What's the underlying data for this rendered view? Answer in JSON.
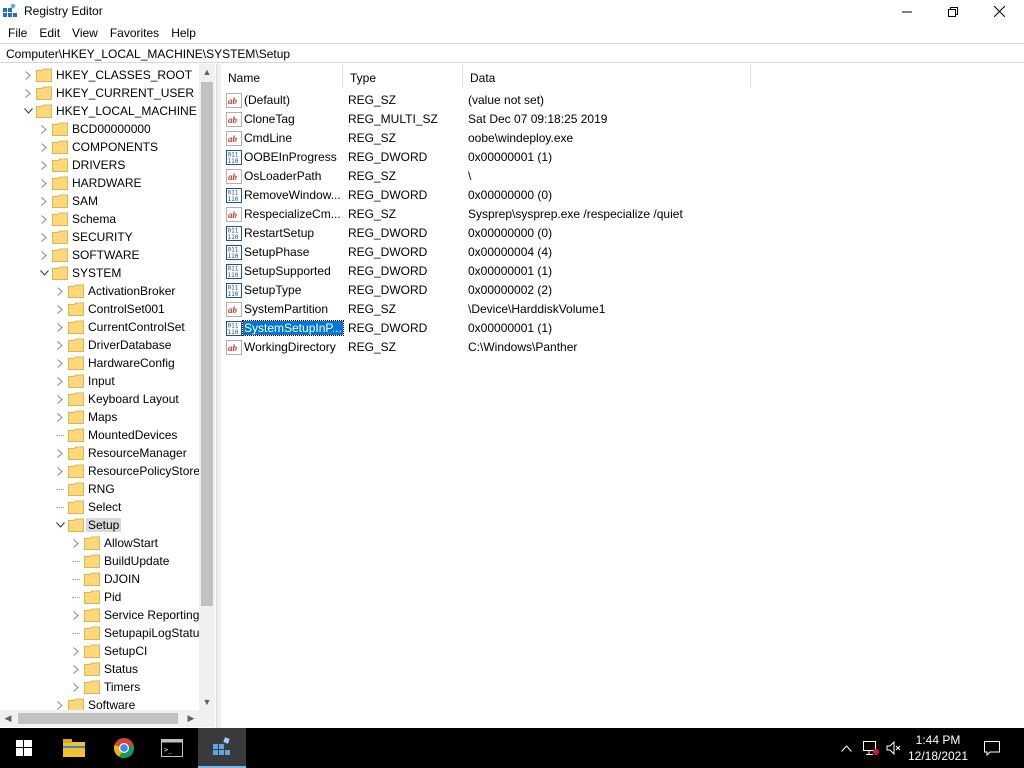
{
  "window": {
    "title": "Registry Editor"
  },
  "menu": [
    "File",
    "Edit",
    "View",
    "Favorites",
    "Help"
  ],
  "address": "Computer\\HKEY_LOCAL_MACHINE\\SYSTEM\\Setup",
  "tree": [
    {
      "label": "HKEY_CLASSES_ROOT",
      "level": 0,
      "expander": "collapsed"
    },
    {
      "label": "HKEY_CURRENT_USER",
      "level": 0,
      "expander": "collapsed"
    },
    {
      "label": "HKEY_LOCAL_MACHINE",
      "level": 0,
      "expander": "expanded"
    },
    {
      "label": "BCD00000000",
      "level": 1,
      "expander": "collapsed"
    },
    {
      "label": "COMPONENTS",
      "level": 1,
      "expander": "collapsed"
    },
    {
      "label": "DRIVERS",
      "level": 1,
      "expander": "collapsed"
    },
    {
      "label": "HARDWARE",
      "level": 1,
      "expander": "collapsed"
    },
    {
      "label": "SAM",
      "level": 1,
      "expander": "collapsed"
    },
    {
      "label": "Schema",
      "level": 1,
      "expander": "collapsed"
    },
    {
      "label": "SECURITY",
      "level": 1,
      "expander": "collapsed"
    },
    {
      "label": "SOFTWARE",
      "level": 1,
      "expander": "collapsed"
    },
    {
      "label": "SYSTEM",
      "level": 1,
      "expander": "expanded"
    },
    {
      "label": "ActivationBroker",
      "level": 2,
      "expander": "collapsed"
    },
    {
      "label": "ControlSet001",
      "level": 2,
      "expander": "collapsed"
    },
    {
      "label": "CurrentControlSet",
      "level": 2,
      "expander": "collapsed"
    },
    {
      "label": "DriverDatabase",
      "level": 2,
      "expander": "collapsed"
    },
    {
      "label": "HardwareConfig",
      "level": 2,
      "expander": "collapsed"
    },
    {
      "label": "Input",
      "level": 2,
      "expander": "collapsed"
    },
    {
      "label": "Keyboard Layout",
      "level": 2,
      "expander": "collapsed"
    },
    {
      "label": "Maps",
      "level": 2,
      "expander": "collapsed"
    },
    {
      "label": "MountedDevices",
      "level": 2,
      "expander": "none"
    },
    {
      "label": "ResourceManager",
      "level": 2,
      "expander": "collapsed"
    },
    {
      "label": "ResourcePolicyStore",
      "level": 2,
      "expander": "collapsed"
    },
    {
      "label": "RNG",
      "level": 2,
      "expander": "none"
    },
    {
      "label": "Select",
      "level": 2,
      "expander": "none"
    },
    {
      "label": "Setup",
      "level": 2,
      "expander": "expanded",
      "selected": true
    },
    {
      "label": "AllowStart",
      "level": 3,
      "expander": "collapsed"
    },
    {
      "label": "BuildUpdate",
      "level": 3,
      "expander": "none"
    },
    {
      "label": "DJOIN",
      "level": 3,
      "expander": "none"
    },
    {
      "label": "Pid",
      "level": 3,
      "expander": "none"
    },
    {
      "label": "Service Reporting",
      "level": 3,
      "expander": "collapsed"
    },
    {
      "label": "SetupapiLogStatu",
      "level": 3,
      "expander": "none"
    },
    {
      "label": "SetupCI",
      "level": 3,
      "expander": "collapsed"
    },
    {
      "label": "Status",
      "level": 3,
      "expander": "collapsed"
    },
    {
      "label": "Timers",
      "level": 3,
      "expander": "collapsed"
    },
    {
      "label": "Software",
      "level": 2,
      "expander": "collapsed"
    }
  ],
  "columns": [
    "Name",
    "Type",
    "Data"
  ],
  "values": [
    {
      "name": "(Default)",
      "type": "REG_SZ",
      "data": "(value not set)",
      "icon": "string-value-icon"
    },
    {
      "name": "CloneTag",
      "type": "REG_MULTI_SZ",
      "data": "Sat Dec 07 09:18:25 2019",
      "icon": "string-value-icon"
    },
    {
      "name": "CmdLine",
      "type": "REG_SZ",
      "data": "oobe\\windeploy.exe",
      "icon": "string-value-icon"
    },
    {
      "name": "OOBEInProgress",
      "type": "REG_DWORD",
      "data": "0x00000001 (1)",
      "icon": "binary-value-icon"
    },
    {
      "name": "OsLoaderPath",
      "type": "REG_SZ",
      "data": "\\",
      "icon": "string-value-icon"
    },
    {
      "name": "RemoveWindow...",
      "type": "REG_DWORD",
      "data": "0x00000000 (0)",
      "icon": "binary-value-icon"
    },
    {
      "name": "RespecializeCm...",
      "type": "REG_SZ",
      "data": "Sysprep\\sysprep.exe /respecialize /quiet",
      "icon": "string-value-icon"
    },
    {
      "name": "RestartSetup",
      "type": "REG_DWORD",
      "data": "0x00000000 (0)",
      "icon": "binary-value-icon"
    },
    {
      "name": "SetupPhase",
      "type": "REG_DWORD",
      "data": "0x00000004 (4)",
      "icon": "binary-value-icon"
    },
    {
      "name": "SetupSupported",
      "type": "REG_DWORD",
      "data": "0x00000001 (1)",
      "icon": "binary-value-icon"
    },
    {
      "name": "SetupType",
      "type": "REG_DWORD",
      "data": "0x00000002 (2)",
      "icon": "binary-value-icon"
    },
    {
      "name": "SystemPartition",
      "type": "REG_SZ",
      "data": "\\Device\\HarddiskVolume1",
      "icon": "string-value-icon"
    },
    {
      "name": "SystemSetupInP...",
      "type": "REG_DWORD",
      "data": "0x00000001 (1)",
      "icon": "binary-value-icon",
      "selected": true
    },
    {
      "name": "WorkingDirectory",
      "type": "REG_SZ",
      "data": "C:\\Windows\\Panther",
      "icon": "string-value-icon"
    }
  ],
  "taskbar": {
    "items": [
      "start-icon",
      "file-explorer-icon",
      "chrome-icon",
      "command-prompt-icon",
      "registry-editor-icon"
    ],
    "active": "registry-editor-icon",
    "clock_time": "1:44 PM",
    "clock_date": "12/18/2021"
  }
}
